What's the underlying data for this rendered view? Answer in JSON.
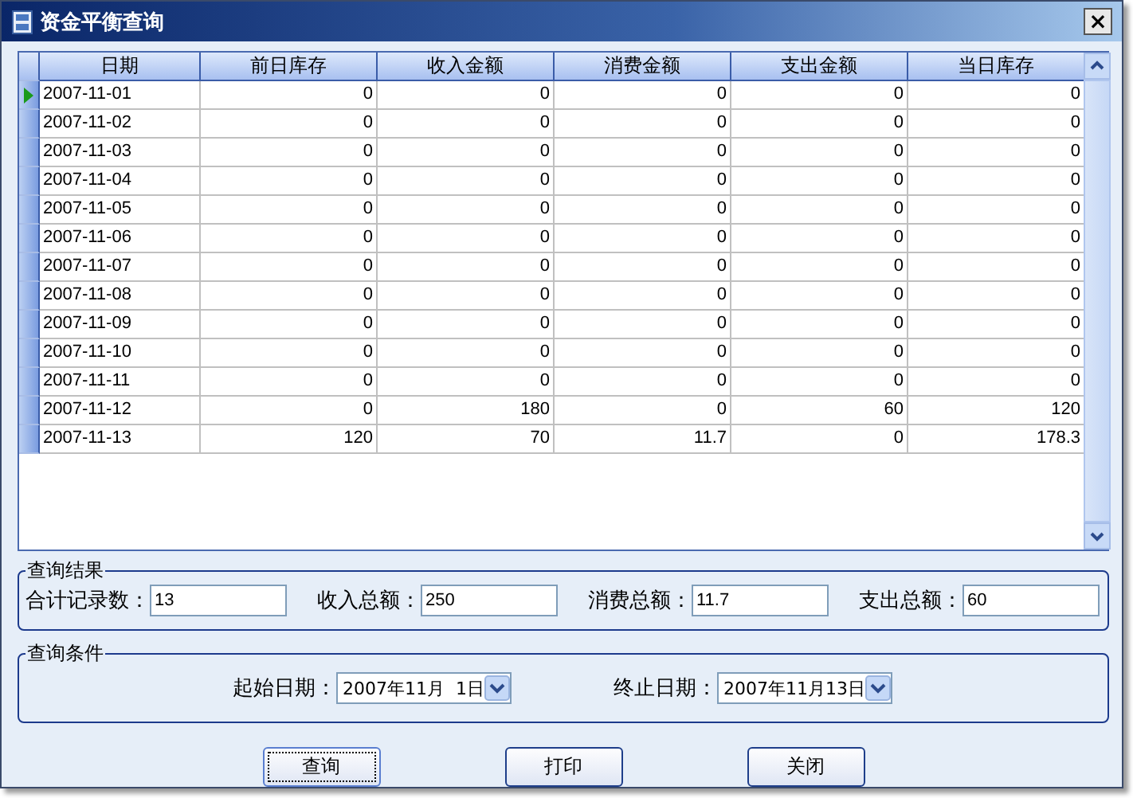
{
  "window": {
    "title": "资金平衡查询",
    "close": "×"
  },
  "table": {
    "columns": [
      "日期",
      "前日库存",
      "收入金额",
      "消费金额",
      "支出金额",
      "当日库存"
    ],
    "rows": [
      {
        "selected": true,
        "cells": [
          "2007-11-01",
          "0",
          "0",
          "0",
          "0",
          "0"
        ]
      },
      {
        "selected": false,
        "cells": [
          "2007-11-02",
          "0",
          "0",
          "0",
          "0",
          "0"
        ]
      },
      {
        "selected": false,
        "cells": [
          "2007-11-03",
          "0",
          "0",
          "0",
          "0",
          "0"
        ]
      },
      {
        "selected": false,
        "cells": [
          "2007-11-04",
          "0",
          "0",
          "0",
          "0",
          "0"
        ]
      },
      {
        "selected": false,
        "cells": [
          "2007-11-05",
          "0",
          "0",
          "0",
          "0",
          "0"
        ]
      },
      {
        "selected": false,
        "cells": [
          "2007-11-06",
          "0",
          "0",
          "0",
          "0",
          "0"
        ]
      },
      {
        "selected": false,
        "cells": [
          "2007-11-07",
          "0",
          "0",
          "0",
          "0",
          "0"
        ]
      },
      {
        "selected": false,
        "cells": [
          "2007-11-08",
          "0",
          "0",
          "0",
          "0",
          "0"
        ]
      },
      {
        "selected": false,
        "cells": [
          "2007-11-09",
          "0",
          "0",
          "0",
          "0",
          "0"
        ]
      },
      {
        "selected": false,
        "cells": [
          "2007-11-10",
          "0",
          "0",
          "0",
          "0",
          "0"
        ]
      },
      {
        "selected": false,
        "cells": [
          "2007-11-11",
          "0",
          "0",
          "0",
          "0",
          "0"
        ]
      },
      {
        "selected": false,
        "cells": [
          "2007-11-12",
          "0",
          "180",
          "0",
          "60",
          "120"
        ]
      },
      {
        "selected": false,
        "cells": [
          "2007-11-13",
          "120",
          "70",
          "11.7",
          "0",
          "178.3"
        ]
      }
    ]
  },
  "results": {
    "title": "查询结果",
    "fields": [
      {
        "label": "合计记录数：",
        "value": "13"
      },
      {
        "label": "收入总额：",
        "value": "250"
      },
      {
        "label": "消费总额：",
        "value": "11.7"
      },
      {
        "label": "支出总额：",
        "value": "60"
      }
    ]
  },
  "conditions": {
    "title": "查询条件",
    "fields": [
      {
        "label": "起始日期：",
        "value": "2007年11月  1日"
      },
      {
        "label": "终止日期：",
        "value": "2007年11月13日"
      }
    ]
  },
  "buttons": [
    {
      "label": "查询",
      "focused": true
    },
    {
      "label": "打印",
      "focused": false
    },
    {
      "label": "关闭",
      "focused": false
    }
  ]
}
